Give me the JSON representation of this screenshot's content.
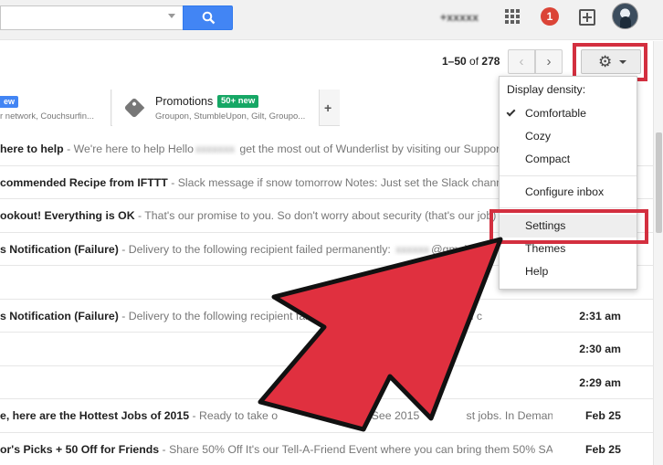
{
  "topbar": {
    "search_placeholder": "",
    "account_name": "+xxxxx",
    "notification_count": "1"
  },
  "toolbar": {
    "range": "1–50",
    "of_word": "of",
    "total": "278",
    "prev_icon": "chevron-left-icon",
    "next_icon": "chevron-right-icon",
    "gear_icon": "gear-icon"
  },
  "tabs": {
    "social": {
      "badge": "ew",
      "sub": "r network, Couchsurfin..."
    },
    "promotions": {
      "title": "Promotions",
      "badge": "50+ new",
      "sub": "Groupon, StumbleUpon, Gilt, Groupo..."
    },
    "add_label": "+"
  },
  "emails": [
    {
      "subject": "here to help",
      "sep": " - ",
      "preview": "We're here to help Hello",
      "blur": "xxxxxxx",
      "preview2": " get the most out of Wunderlist by visiting our Support Ce",
      "date": ""
    },
    {
      "subject": "commended Recipe from IFTTT",
      "sep": " - ",
      "preview": "Slack message if snow tomorrow Notes: Just set the Slack channel an",
      "blur": "",
      "preview2": "",
      "date": ""
    },
    {
      "subject": "ookout! Everything is OK",
      "sep": " - ",
      "preview": "That's our promise to you. So don't worry about security (that's our job) but",
      "blur": "",
      "preview2": "",
      "date": ""
    },
    {
      "subject": "s Notification (Failure)",
      "sep": " - ",
      "preview": "Delivery to the following recipient failed permanently: ",
      "blur": "xxxxxx",
      "preview2": "@gmai",
      "date": ""
    },
    {
      "subject": "",
      "sep": "",
      "preview": "",
      "blur": "",
      "preview2": "",
      "date": ""
    },
    {
      "subject": "s Notification (Failure)",
      "sep": " - ",
      "preview": "Delivery to the following recipient faile",
      "blur": "",
      "preview2": "                         il.com Technical c",
      "date": "2:31 am"
    },
    {
      "subject": "",
      "sep": "",
      "preview": "",
      "blur": "",
      "preview2": "",
      "date": "2:30 am"
    },
    {
      "subject": "",
      "sep": "",
      "preview": "",
      "blur": "",
      "preview2": "",
      "date": "2:29 am"
    },
    {
      "subject": "e, here are the Hottest Jobs of 2015",
      "sep": " - ",
      "preview": "Ready to take o",
      "blur": "",
      "preview2": "                         e? See 2015               st jobs. In Demand Jobs Hi e",
      "date": "Feb 25"
    },
    {
      "subject": "or's Picks + 50 Off for Friends",
      "sep": " - ",
      "preview": "Share 50% Off It's our Tell-A-Friend Event where you can bring them 50% SAVIN",
      "blur": "",
      "preview2": "",
      "date": "Feb 25"
    }
  ],
  "menu": {
    "header": "Display density:",
    "items": [
      "Comfortable",
      "Cozy",
      "Compact",
      "Configure inbox",
      "Settings",
      "Themes",
      "Help"
    ]
  },
  "colors": {
    "highlight": "#d32f3f",
    "arrow_fill": "#e0303f",
    "search_button": "#4285f4",
    "promo_badge": "#16a765"
  }
}
